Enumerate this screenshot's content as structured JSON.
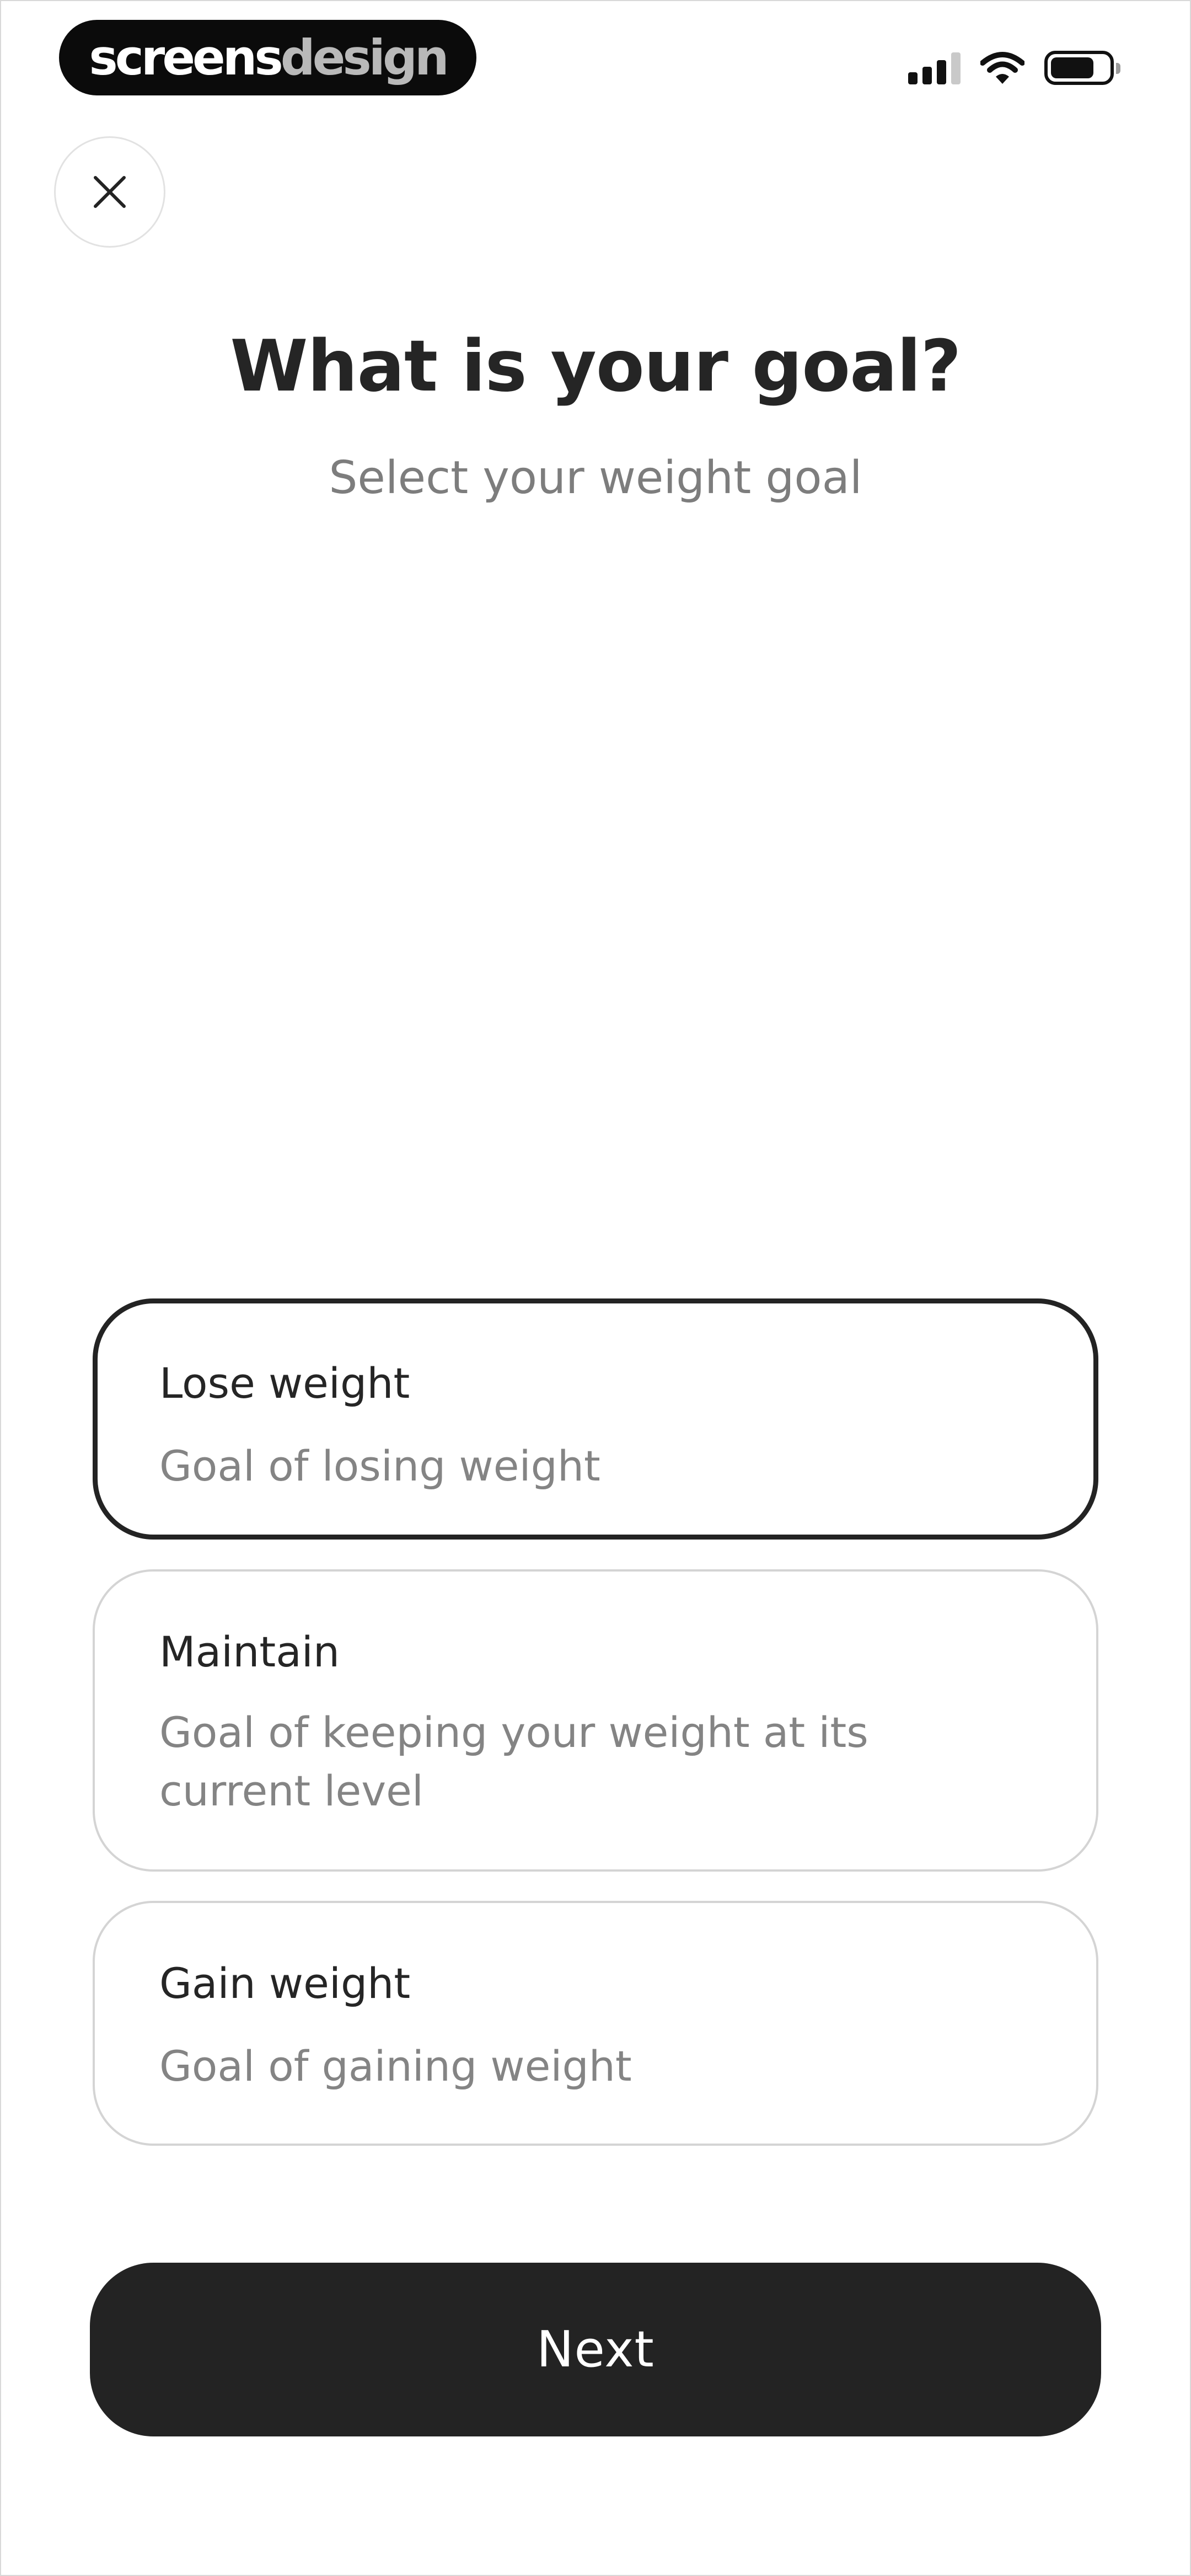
{
  "status_bar": {
    "brand_part1": "screens",
    "brand_part2": "design",
    "icons": [
      "signal-icon",
      "wifi-icon",
      "battery-icon"
    ],
    "battery_level": 0.75
  },
  "header": {
    "close_icon": "close-icon",
    "title": "What is your goal?",
    "subtitle": "Select your weight goal"
  },
  "options": [
    {
      "title": "Lose weight",
      "description": "Goal of losing weight",
      "selected": true
    },
    {
      "title": "Maintain",
      "description": "Goal of keeping your weight at its current level",
      "selected": false
    },
    {
      "title": "Gain weight",
      "description": "Goal of gaining weight",
      "selected": false
    }
  ],
  "footer": {
    "next_label": "Next"
  },
  "colors": {
    "primary": "#232323",
    "secondary_text": "#7d7d7d",
    "card_border": "#d4d4d4",
    "background": "#ffffff"
  }
}
